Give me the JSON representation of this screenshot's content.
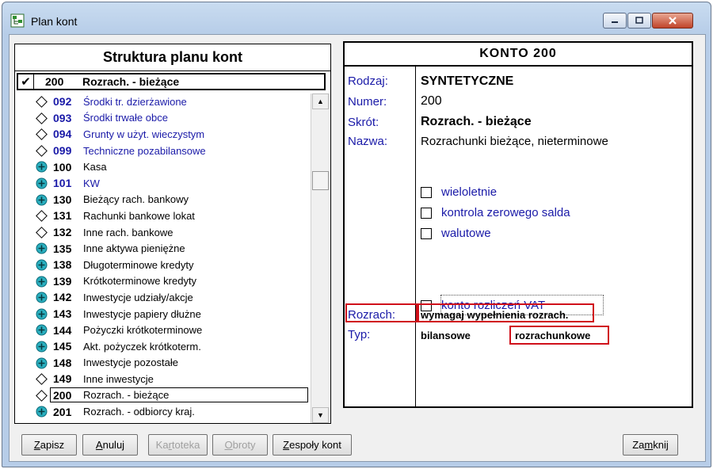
{
  "window": {
    "title": "Plan kont"
  },
  "left": {
    "header": "Struktura planu kont",
    "selected": {
      "num": "200",
      "name": "Rozrach. - bieżące"
    },
    "rows": [
      {
        "num": "092",
        "name": "Środki tr. dzierżawione",
        "icon": "diamond",
        "blue": true
      },
      {
        "num": "093",
        "name": "Środki trwałe obce",
        "icon": "diamond",
        "blue": true
      },
      {
        "num": "094",
        "name": "Grunty w użyt. wieczystym",
        "icon": "diamond",
        "blue": true
      },
      {
        "num": "099",
        "name": "Techniczne pozabilansowe",
        "icon": "diamond",
        "blue": true
      },
      {
        "num": "100",
        "name": "Kasa",
        "icon": "plus",
        "blue": false
      },
      {
        "num": "101",
        "name": "KW",
        "icon": "plus",
        "blue": true
      },
      {
        "num": "130",
        "name": "Bieżący rach. bankowy",
        "icon": "plus",
        "blue": false
      },
      {
        "num": "131",
        "name": "Rachunki bankowe lokat",
        "icon": "diamond",
        "blue": false
      },
      {
        "num": "132",
        "name": "Inne rach. bankowe",
        "icon": "diamond",
        "blue": false
      },
      {
        "num": "135",
        "name": "Inne aktywa pieniężne",
        "icon": "plus",
        "blue": false
      },
      {
        "num": "138",
        "name": "Długoterminowe kredyty",
        "icon": "plus",
        "blue": false
      },
      {
        "num": "139",
        "name": "Krótkoterminowe kredyty",
        "icon": "plus",
        "blue": false
      },
      {
        "num": "142",
        "name": "Inwestycje udziały/akcje",
        "icon": "plus",
        "blue": false
      },
      {
        "num": "143",
        "name": "Inwestycje papiery dłużne",
        "icon": "plus",
        "blue": false
      },
      {
        "num": "144",
        "name": "Pożyczki krótkoterminowe",
        "icon": "plus",
        "blue": false
      },
      {
        "num": "145",
        "name": "Akt. pożyczek krótkoterm.",
        "icon": "plus",
        "blue": false
      },
      {
        "num": "148",
        "name": "Inwestycje pozostałe",
        "icon": "plus",
        "blue": false
      },
      {
        "num": "149",
        "name": "Inne inwestycje",
        "icon": "diamond",
        "blue": false
      },
      {
        "num": "200",
        "name": "Rozrach. - bieżące",
        "icon": "diamond",
        "blue": false,
        "focus": true
      },
      {
        "num": "201",
        "name": "Rozrach. - odbiorcy kraj.",
        "icon": "plus",
        "blue": false
      }
    ]
  },
  "right": {
    "header": "KONTO  200",
    "labels": {
      "rodzaj": "Rodzaj:",
      "numer": "Numer:",
      "skrot": "Skrót:",
      "nazwa": "Nazwa:",
      "rozrach": "Rozrach:",
      "typ": "Typ:"
    },
    "values": {
      "rodzaj": "SYNTETYCZNE",
      "numer": "200",
      "skrot": "Rozrach. - bieżące",
      "nazwa": "Rozrachunki bieżące, nieterminowe",
      "rozrach": "wymagaj wypełnienia rozrach.",
      "typ_bilans": "bilansowe",
      "typ_rozrach": "rozrachunkowe"
    },
    "checkboxes": {
      "wieloletnie": "wieloletnie",
      "kontrola": "kontrola zerowego salda",
      "walutowe": "walutowe",
      "vat": "konto rozliczeń VAT"
    }
  },
  "buttons": {
    "zapisz": {
      "u": "Z",
      "rest": "apisz"
    },
    "anuluj": {
      "u": "A",
      "rest": "nuluj"
    },
    "kartoteka": {
      "pre": "Ka",
      "u": "r",
      "rest": "toteka"
    },
    "obroty": {
      "u": "O",
      "rest": "broty"
    },
    "zespoly": {
      "u": "Z",
      "rest": "espoły kont"
    },
    "zamknij": {
      "pre": "Za",
      "u": "m",
      "rest": "knij"
    }
  },
  "colors": {
    "accent_blue": "#1a1aa8",
    "highlight_red": "#d0101a",
    "plus_icon": "#0a7a8a"
  }
}
